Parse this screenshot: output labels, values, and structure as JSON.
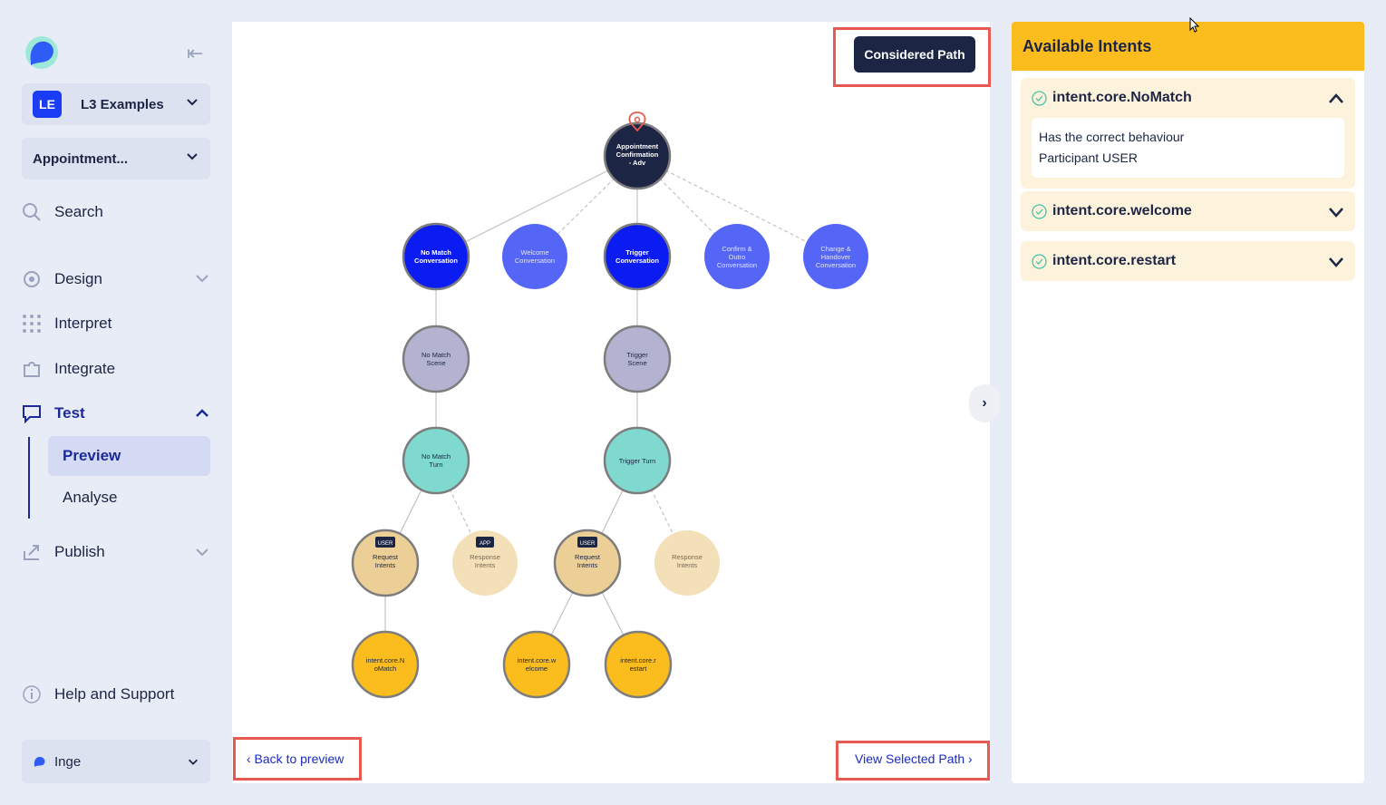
{
  "workspace": {
    "badge": "LE",
    "name": "L3 Examples"
  },
  "scenario_select": {
    "value": "Appointment..."
  },
  "nav": {
    "search": "Search",
    "design": "Design",
    "interpret": "Interpret",
    "integrate": "Integrate",
    "test": "Test",
    "preview": "Preview",
    "analyse": "Analyse",
    "publish": "Publish",
    "help": "Help and Support"
  },
  "user": {
    "name": "Inge"
  },
  "toolbar": {
    "considered_path": "Considered Path",
    "back": "‹ Back to preview",
    "view_selected": "View Selected Path ›"
  },
  "graph": {
    "root": "Appointment Confirmation - Adv",
    "conv_nomatch": [
      "No Match",
      "Conversation"
    ],
    "conv_welcome": [
      "Welcome",
      "Conversation"
    ],
    "conv_trigger": [
      "Trigger",
      "Conversation"
    ],
    "conv_confirm": [
      "Confirm &",
      "Outro",
      "Conversation"
    ],
    "conv_change": [
      "Change &",
      "Handover",
      "Conversation"
    ],
    "scene_nomatch": [
      "No Match",
      "Scene"
    ],
    "scene_trigger": [
      "Trigger",
      "Scene"
    ],
    "turn_nomatch": [
      "No Match",
      "Turn"
    ],
    "turn_trigger": "Trigger Turn",
    "tag_user": "USER",
    "tag_app": "APP",
    "request_intents": [
      "Request",
      "Intents"
    ],
    "response_intents": [
      "Response",
      "Intents"
    ],
    "intent_nomatch": [
      "intent.core.N",
      "oMatch"
    ],
    "intent_welcome": [
      "intent.core.w",
      "elcome"
    ],
    "intent_restart": [
      "intent.core.r",
      "estart"
    ]
  },
  "panel": {
    "title": "Available Intents",
    "intents": [
      {
        "name": "intent.core.NoMatch",
        "line1": "Has the correct behaviour",
        "line2": "Participant USER"
      },
      {
        "name": "intent.core.welcome"
      },
      {
        "name": "intent.core.restart"
      }
    ]
  },
  "colors": {
    "navy": "#1c2544",
    "blue_dark": "#0b1cf3",
    "blue_light": "#5566f6",
    "scene": "#b3b3d1",
    "turn": "#7fd9cf",
    "intent_tan": "#ebcf96",
    "intent_tan_light": "#f3dfb8",
    "intent_yellow": "#fbbd1e",
    "accent_red": "#e85a4f"
  }
}
